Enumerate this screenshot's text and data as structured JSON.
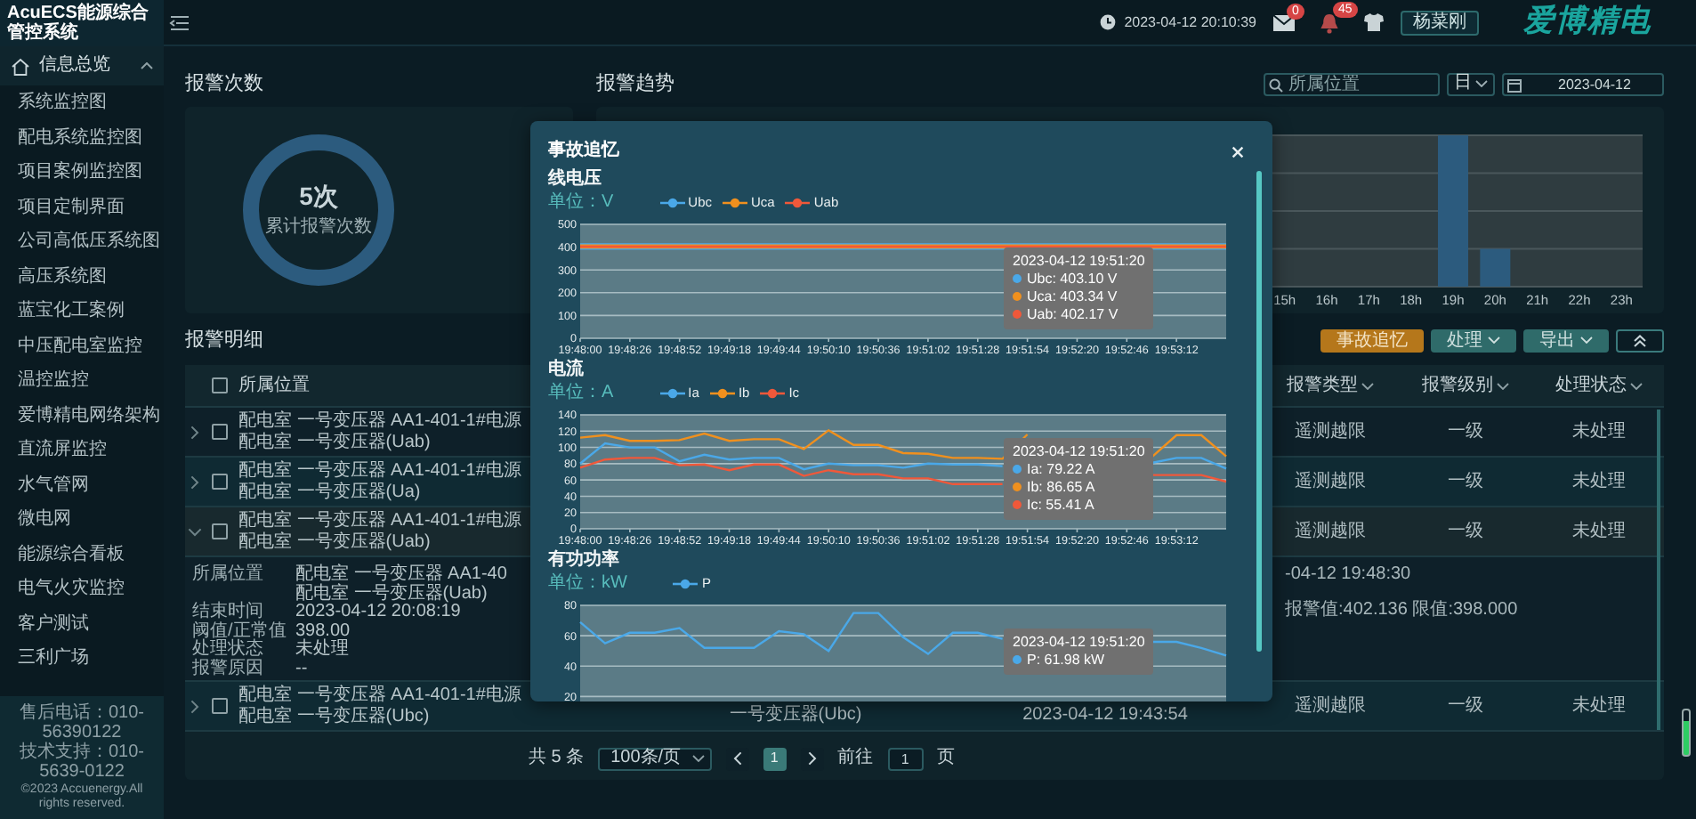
{
  "sidebar": {
    "brand": "AcuECS能源综合管控系统",
    "group": {
      "label": "信息总览",
      "selected": true,
      "expanded": true
    },
    "items": [
      {
        "label": "系统监控图",
        "selected": false
      },
      {
        "label": "配电系统监控图",
        "selected": false
      },
      {
        "label": "项目案例监控图",
        "selected": false
      },
      {
        "label": "项目定制界面",
        "selected": false
      },
      {
        "label": "公司高低压系统图",
        "selected": false
      },
      {
        "label": "高压系统图",
        "selected": false
      },
      {
        "label": "蓝宝化工案例",
        "selected": false
      },
      {
        "label": "中压配电室监控",
        "selected": false
      },
      {
        "label": "温控监控",
        "selected": false
      },
      {
        "label": "爱博精电网络架构",
        "selected": false
      },
      {
        "label": "直流屏监控",
        "selected": false
      },
      {
        "label": "水气管网",
        "selected": false
      },
      {
        "label": "微电网",
        "selected": false
      },
      {
        "label": "能源综合看板",
        "selected": false
      },
      {
        "label": "电气火灾监控",
        "selected": false
      },
      {
        "label": "客户测试",
        "selected": false
      },
      {
        "label": "三利广场",
        "selected": false
      }
    ],
    "footer": [
      "售后电话：010-56390122",
      "技术支持：010-5639-0122",
      "©2023 Accuenergy.All rights reserved."
    ]
  },
  "header": {
    "datetime": "2023-04-12 20:10:39",
    "notifications": [
      {
        "kind": "mail",
        "count": "0"
      },
      {
        "kind": "alert",
        "count": "45"
      }
    ],
    "user_button": "杨菜刚",
    "logo": "爱博精电"
  },
  "alarm_count": {
    "title": "报警次数",
    "value": "5次",
    "caption": "累计报警次数"
  },
  "alarm_trend": {
    "title": "报警趋势",
    "search_placeholder": "所属位置",
    "period": "日",
    "date": "2023-04-12",
    "axis_labels": [
      "15h",
      "16h",
      "17h",
      "18h",
      "19h",
      "20h",
      "21h",
      "22h",
      "23h"
    ]
  },
  "alarm_detail": {
    "title": "报警明细",
    "buttons": [
      {
        "kind": "primary",
        "label": "事故追忆"
      },
      {
        "kind": "dropdown",
        "label": "处理"
      },
      {
        "kind": "dropdown",
        "label": "导出"
      },
      {
        "kind": "collapse"
      }
    ]
  },
  "alarm_table": {
    "header_checked": false,
    "columns": [
      {
        "label": "所属位置",
        "sortable": false
      },
      {
        "label": "报警类型",
        "sortable": true
      },
      {
        "label": "报警级别",
        "sortable": true
      },
      {
        "label": "处理状态",
        "sortable": true
      }
    ],
    "rows": [
      {
        "location": [
          "配电室 一号变压器 AA1-401-1#电源",
          "配电室 一号变压器(Uab)"
        ],
        "alarm_type": "遥测越限",
        "level": "一级",
        "status": "未处理",
        "checked": false,
        "expanded": false
      },
      {
        "location": [
          "配电室 一号变压器 AA1-401-1#电源",
          "配电室 一号变压器(Ua)"
        ],
        "alarm_type": "遥测越限",
        "level": "一级",
        "status": "未处理",
        "checked": false,
        "expanded": false
      },
      {
        "location": [
          "配电室 一号变压器 AA1-401-1#电源",
          "配电室 一号变压器(Uab)"
        ],
        "alarm_type": "遥测越限",
        "level": "一级",
        "status": "未处理",
        "checked": false,
        "expanded": true,
        "detail": {
          "fields": [
            {
              "label": "所属位置",
              "lines": [
                "配电室 一号变压器 AA1-40",
                "配电室 一号变压器(Uab)"
              ]
            },
            {
              "label": "结束时间",
              "lines": [
                "2023-04-12 20:08:19"
              ]
            },
            {
              "label": "阈值/正常值",
              "lines": [
                "398.00"
              ]
            },
            {
              "label": "处理状态",
              "lines": [
                "未处理"
              ]
            },
            {
              "label": "报警原因",
              "lines": [
                "--"
              ]
            }
          ],
          "extra": [
            "-04-12 19:48:30",
            "报警值:402.136 限值:398.000"
          ]
        }
      },
      {
        "location": [
          "配电室 一号变压器 AA1-401-1#电源",
          "配电室 一号变压器(Ubc)"
        ],
        "column_3": "一号变压器(Ubc)",
        "column_4": "2023-04-12 19:43:54",
        "alarm_type": "遥测越限",
        "level": "一级",
        "status": "未处理",
        "checked": false,
        "expanded": false
      }
    ],
    "pagination": {
      "total": "共 5 条",
      "page_size": "100条/页",
      "pages": [
        {
          "label": "1",
          "selected": true
        }
      ],
      "goto_label": "前往",
      "goto_value": "1",
      "goto_suffix": "页"
    }
  },
  "modal": {
    "title": "事故追忆",
    "charts": [
      {
        "chart_data": {
          "type": "line",
          "title": "线电压",
          "ylabel": "单位：V",
          "categories": [
            "19:48:00",
            null,
            "19:48:26",
            null,
            "19:48:52",
            null,
            "19:49:18",
            null,
            "19:49:44",
            null,
            "19:50:10",
            null,
            "19:50:36",
            null,
            "19:51:02",
            null,
            "19:51:28",
            null,
            "19:51:54",
            null,
            "19:52:20",
            null,
            "19:52:46",
            null,
            "19:53:12",
            null,
            null
          ],
          "ylim": [
            0,
            500
          ],
          "grid": true,
          "yticks": [
            0,
            100,
            200,
            300,
            400,
            500
          ],
          "series": [
            {
              "name": "Ubc",
              "color": "#4aa8e8",
              "values": [
                403,
                403,
                403,
                403,
                403,
                403,
                403,
                403,
                403,
                403,
                403,
                403,
                403,
                403,
                403,
                403,
                403,
                403,
                403,
                403,
                403,
                403,
                403,
                403,
                403,
                403,
                403
              ]
            },
            {
              "name": "Uca",
              "color": "#f0901e",
              "values": [
                403,
                403,
                403,
                403,
                403,
                403,
                403,
                403,
                403,
                403,
                403,
                403,
                403,
                403,
                403,
                403,
                403,
                403,
                403,
                403,
                403,
                403,
                403,
                403,
                403,
                403,
                403
              ]
            },
            {
              "name": "Uab",
              "color": "#f0583a",
              "values": [
                402,
                402,
                402,
                402,
                402,
                402,
                402,
                402,
                402,
                402,
                402,
                402,
                402,
                402,
                402,
                402,
                402,
                402,
                402,
                402,
                402,
                402,
                402,
                402,
                402,
                402,
                402
              ]
            }
          ]
        },
        "tooltip": {
          "time": "2023-04-12 19:51:20",
          "values": [
            "Ubc: 403.10 V",
            "Uca: 403.34 V",
            "Uab: 402.17 V"
          ]
        }
      },
      {
        "chart_data": {
          "type": "line",
          "title": "电流",
          "ylabel": "单位：A",
          "categories": [
            "19:48:00",
            null,
            "19:48:26",
            null,
            "19:48:52",
            null,
            "19:49:18",
            null,
            "19:49:44",
            null,
            "19:50:10",
            null,
            "19:50:36",
            null,
            "19:51:02",
            null,
            "19:51:28",
            null,
            "19:51:54",
            null,
            "19:52:20",
            null,
            "19:52:46",
            null,
            "19:53:12",
            null,
            null
          ],
          "ylim": [
            0,
            140
          ],
          "grid": true,
          "yticks": [
            0,
            20,
            40,
            60,
            80,
            100,
            120,
            140
          ],
          "series": [
            {
              "name": "Ia",
              "color": "#4aa8e8",
              "values": [
                80,
                105,
                100,
                100,
                83,
                91,
                85,
                87,
                87,
                73,
                80,
                78,
                78,
                75,
                80,
                79,
                79,
                77,
                null,
                null,
                null,
                null,
                null,
                81,
                87,
                87,
                74
              ]
            },
            {
              "name": "Ib",
              "color": "#f0901e",
              "values": [
                112,
                115,
                108,
                108,
                109,
                117,
                108,
                110,
                110,
                98,
                121,
                103,
                103,
                93,
                92,
                87,
                87,
                86,
                116,
                null,
                null,
                null,
                null,
                88,
                115,
                115,
                89
              ]
            },
            {
              "name": "Ic",
              "color": "#f0583a",
              "values": [
                75,
                85,
                87,
                87,
                78,
                79,
                72,
                79,
                79,
                65,
                72,
                67,
                67,
                62,
                62,
                55,
                55,
                55,
                null,
                null,
                null,
                null,
                null,
                66,
                66,
                66,
                58
              ]
            }
          ]
        },
        "tooltip": {
          "time": "2023-04-12 19:51:20",
          "values": [
            "Ia: 79.22 A",
            "Ib: 86.65 A",
            "Ic: 55.41 A"
          ]
        }
      },
      {
        "chart_data": {
          "type": "line",
          "title": "有功功率",
          "ylabel": "单位：kW",
          "categories": [
            null,
            null,
            null,
            null,
            null,
            null,
            null,
            null,
            null,
            null,
            null,
            null,
            null,
            null,
            null,
            null,
            null,
            null,
            null,
            null,
            null,
            null,
            null,
            null,
            null,
            null,
            null
          ],
          "ylim": [
            5,
            80
          ],
          "grid": true,
          "yticks": [
            20,
            40,
            60,
            80
          ],
          "series": [
            {
              "name": "P",
              "color": "#4aa8e8",
              "values": [
                69,
                55,
                62,
                62,
                65,
                52,
                52,
                52,
                63,
                61,
                50,
                75,
                75,
                59,
                48,
                62,
                62,
                58,
                null,
                null,
                null,
                null,
                null,
                56,
                56,
                52,
                47
              ]
            }
          ]
        },
        "tooltip": {
          "time": "2023-04-12 19:51:20",
          "values": [
            "P: 61.98 kW"
          ]
        }
      }
    ]
  }
}
